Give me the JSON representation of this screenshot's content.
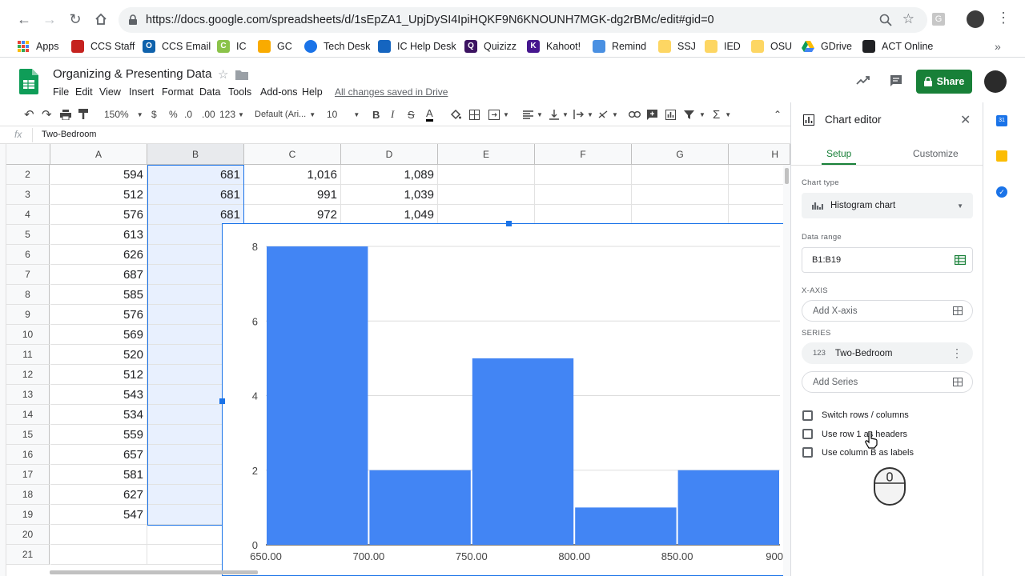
{
  "browser": {
    "url": "https://docs.google.com/spreadsheets/d/1sEpZA1_UpjDySI4IpiHQKF9N6KNOUNH7MGK-dg2rBMc/edit#gid=0"
  },
  "bookmarks": [
    {
      "label": "Apps",
      "color": "#ea4335"
    },
    {
      "label": "CCS Staff",
      "color": "#c5221f"
    },
    {
      "label": "CCS Email",
      "color": "#0f62ac"
    },
    {
      "label": "IC",
      "color": "#8bc34a"
    },
    {
      "label": "GC",
      "color": "#f9ab00"
    },
    {
      "label": "Tech Desk",
      "color": "#1a73e8"
    },
    {
      "label": "IC Help Desk",
      "color": "#1565c0"
    },
    {
      "label": "Quizizz",
      "color": "#3c1361"
    },
    {
      "label": "Kahoot!",
      "color": "#46178f"
    },
    {
      "label": "Remind",
      "color": "#4a90e2"
    },
    {
      "label": "SSJ",
      "color": "#fdd663"
    },
    {
      "label": "IED",
      "color": "#fdd663"
    },
    {
      "label": "OSU",
      "color": "#fdd663"
    },
    {
      "label": "GDrive",
      "color": "#0f9d58"
    },
    {
      "label": "ACT Online",
      "color": "#202124"
    }
  ],
  "doc": {
    "title": "Organizing & Presenting Data",
    "menu": [
      "File",
      "Edit",
      "View",
      "Insert",
      "Format",
      "Data",
      "Tools",
      "Add-ons",
      "Help"
    ],
    "saved_status": "All changes saved in Drive",
    "share_label": "Share"
  },
  "toolbar": {
    "zoom": "150%",
    "currency": "$",
    "percent": "%",
    "dec_less": ".0",
    "dec_more": ".00",
    "more_formats": "123",
    "font": "Default (Ari...",
    "font_size": "10"
  },
  "formula_bar": {
    "fx": "fx",
    "content": "Two-Bedroom"
  },
  "grid": {
    "columns": [
      "A",
      "B",
      "C",
      "D",
      "E",
      "F",
      "G",
      "H"
    ],
    "rows": [
      {
        "n": "2",
        "a": "594",
        "b": "681",
        "c": "1,016",
        "d": "1,089"
      },
      {
        "n": "3",
        "a": "512",
        "b": "681",
        "c": "991",
        "d": "1,039"
      },
      {
        "n": "4",
        "a": "576",
        "b": "681",
        "c": "972",
        "d": "1,049"
      },
      {
        "n": "5",
        "a": "613"
      },
      {
        "n": "6",
        "a": "626"
      },
      {
        "n": "7",
        "a": "687"
      },
      {
        "n": "8",
        "a": "585"
      },
      {
        "n": "9",
        "a": "576"
      },
      {
        "n": "10",
        "a": "569"
      },
      {
        "n": "11",
        "a": "520"
      },
      {
        "n": "12",
        "a": "512"
      },
      {
        "n": "13",
        "a": "543"
      },
      {
        "n": "14",
        "a": "534"
      },
      {
        "n": "15",
        "a": "559"
      },
      {
        "n": "16",
        "a": "657"
      },
      {
        "n": "17",
        "a": "581"
      },
      {
        "n": "18",
        "a": "627"
      },
      {
        "n": "19",
        "a": "547"
      },
      {
        "n": "20",
        "a": ""
      },
      {
        "n": "21",
        "a": ""
      }
    ]
  },
  "chart_data": {
    "type": "bar",
    "histogram": true,
    "bins": [
      {
        "start": 650,
        "end": 700,
        "count": 8
      },
      {
        "start": 700,
        "end": 750,
        "count": 2
      },
      {
        "start": 750,
        "end": 800,
        "count": 5
      },
      {
        "start": 800,
        "end": 850,
        "count": 1
      },
      {
        "start": 850,
        "end": 900,
        "count": 2
      }
    ],
    "x_ticks": [
      "650.00",
      "700.00",
      "750.00",
      "800.00",
      "850.00",
      "900"
    ],
    "y_ticks": [
      "0",
      "2",
      "4",
      "6",
      "8"
    ],
    "xlim": [
      650,
      900
    ],
    "ylim": [
      0,
      8
    ],
    "bar_color": "#4285f4",
    "grid": true
  },
  "editor": {
    "title": "Chart editor",
    "tab_setup": "Setup",
    "tab_customize": "Customize",
    "chart_type_label": "Chart type",
    "chart_type_value": "Histogram chart",
    "data_range_label": "Data range",
    "data_range_value": "B1:B19",
    "x_axis_label": "X-AXIS",
    "x_axis_placeholder": "Add X-axis",
    "series_label": "SERIES",
    "series_type_badge": "123",
    "series_name": "Two-Bedroom",
    "add_series": "Add Series",
    "checkboxes": [
      "Switch rows / columns",
      "Use row 1 as headers",
      "Use column B as labels"
    ]
  }
}
